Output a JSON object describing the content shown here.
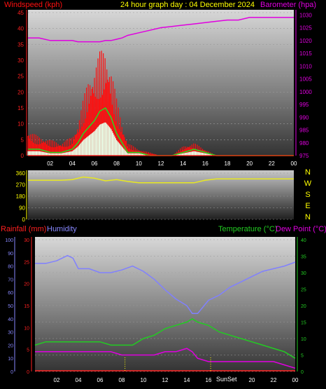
{
  "header": {
    "windspeed_label": "Windspeed (kph)",
    "title": "24 hour graph day : 04 December 2024",
    "barometer_label": "Barometer (hpa)"
  },
  "colors": {
    "gust": "#ff1010",
    "wind_avg": "#22dd22",
    "wind_calm": "#e8ffe8",
    "baro": "#e000e0",
    "direction": "#e8e820",
    "humidity": "#8080ff",
    "temperature": "#22cc22",
    "dewpoint": "#e000e0",
    "rain": "#ff2020",
    "labels_yellow": "#ffff00",
    "labels_red": "#ff2020",
    "labels_blue": "#8888ff",
    "labels_green": "#22cc22"
  },
  "time_ticks": [
    "02",
    "04",
    "06",
    "08",
    "10",
    "12",
    "14",
    "16",
    "18",
    "20",
    "22",
    "00"
  ],
  "panel2": {
    "compass": [
      "N",
      "W",
      "S",
      "E",
      "N"
    ]
  },
  "panel3": {
    "rainfall_label": "Rainfall (mm)",
    "humidity_label": "Humidity",
    "temperature_label": "Temperature (°C)",
    "dewpoint_label": "Dew Point (°C)",
    "sunset_label": "SunSet"
  },
  "chart_data": [
    {
      "type": "line",
      "name_in_chart": "wind",
      "title": "24 hour graph day : 04 December 2024",
      "xlabel": "",
      "ylabel": "Windspeed (kph)",
      "y2label": "Barometer (hpa)",
      "x_hours": [
        0,
        1,
        2,
        3,
        4,
        4.5,
        5,
        5.5,
        6,
        6.5,
        7,
        7.5,
        8,
        8.5,
        9,
        10,
        11,
        12,
        13,
        14,
        15,
        16,
        17,
        18,
        19,
        20,
        21,
        22,
        23,
        24
      ],
      "series": [
        {
          "name": "gust",
          "values": [
            8,
            6,
            5,
            4,
            6,
            10,
            18,
            25,
            28,
            33,
            34,
            28,
            18,
            10,
            4,
            2,
            1,
            0,
            0,
            3,
            4,
            2,
            0,
            0,
            0,
            0,
            0,
            0,
            0,
            0
          ]
        },
        {
          "name": "average",
          "values": [
            2,
            2,
            1,
            1,
            2,
            4,
            7,
            9,
            11,
            14,
            15,
            12,
            7,
            4,
            1,
            1,
            0,
            0,
            0,
            1,
            2,
            1,
            0,
            0,
            0,
            0,
            0,
            0,
            0,
            0
          ]
        }
      ],
      "barometer": [
        1021,
        1021,
        1020,
        1020,
        1020,
        1019.5,
        1019.5,
        1019.5,
        1019.5,
        1019.5,
        1020,
        1020,
        1020.5,
        1021,
        1022,
        1023,
        1024,
        1025,
        1025.5,
        1026,
        1026.5,
        1027,
        1027.5,
        1028,
        1028,
        1029,
        1029,
        1029,
        1029,
        1029
      ],
      "ylim": [
        0,
        45
      ],
      "y2lim": [
        975,
        1032
      ],
      "yticks": [
        0,
        5,
        10,
        15,
        20,
        25,
        30,
        35,
        40,
        45
      ],
      "y2ticks": [
        975,
        980,
        985,
        990,
        995,
        1000,
        1005,
        1010,
        1015,
        1020,
        1025,
        1030
      ]
    },
    {
      "type": "line",
      "name_in_chart": "direction",
      "x_hours": [
        0,
        2,
        3,
        4,
        5,
        6,
        7,
        8,
        9,
        10,
        12,
        14,
        15,
        16,
        17,
        18,
        20,
        22,
        24
      ],
      "values": [
        305,
        305,
        305,
        310,
        330,
        320,
        300,
        310,
        295,
        285,
        285,
        285,
        285,
        305,
        315,
        315,
        315,
        315,
        315
      ],
      "ylim": [
        0,
        360
      ],
      "yticks": [
        0,
        90,
        180,
        270,
        360
      ]
    },
    {
      "type": "line",
      "name_in_chart": "temperature-humidity-rain",
      "x_hours": [
        0,
        1,
        2,
        3,
        3.5,
        4,
        5,
        6,
        7,
        8,
        9,
        10,
        11,
        12,
        13,
        14,
        14.5,
        15,
        16,
        17,
        18,
        19,
        20,
        21,
        22,
        23,
        24
      ],
      "series": [
        {
          "name": "Humidity",
          "values": [
            82,
            82,
            84,
            88,
            86,
            78,
            78,
            75,
            75,
            77,
            80,
            76,
            70,
            62,
            55,
            50,
            44,
            44,
            54,
            58,
            64,
            68,
            72,
            76,
            78,
            80,
            83
          ]
        },
        {
          "name": "Temperature (°C)",
          "values": [
            8,
            9,
            9,
            9,
            9,
            9,
            9,
            9,
            8,
            8,
            8,
            10,
            11,
            13,
            14,
            15,
            16,
            15,
            14,
            12,
            11,
            10,
            9,
            8,
            7,
            6,
            4
          ]
        },
        {
          "name": "Dew Point (°C)",
          "values": [
            6,
            6,
            6,
            6,
            6,
            6,
            6,
            6,
            6,
            5,
            5,
            5,
            5,
            6,
            6,
            7,
            6,
            4,
            3,
            3,
            3,
            3,
            3,
            3,
            3,
            2,
            1
          ]
        },
        {
          "name": "Rainfall (mm)",
          "values": [
            0,
            0,
            0,
            0,
            0,
            0,
            0,
            0,
            0,
            0,
            0,
            0,
            0,
            0,
            0,
            0,
            0,
            0,
            0,
            0,
            0,
            0,
            0,
            0,
            0,
            0,
            0
          ]
        }
      ],
      "ylim_rain": [
        0,
        30
      ],
      "ylim_humidity": [
        0,
        100
      ],
      "ylim_temp": [
        0,
        40
      ],
      "yticks_rain": [
        0,
        5,
        10,
        15,
        20,
        25,
        30
      ],
      "yticks_humidity": [
        0,
        10,
        20,
        30,
        40,
        50,
        60,
        70,
        80,
        90,
        100
      ],
      "yticks_temp": [
        0,
        5,
        10,
        15,
        20,
        25,
        30,
        35,
        40
      ]
    }
  ]
}
